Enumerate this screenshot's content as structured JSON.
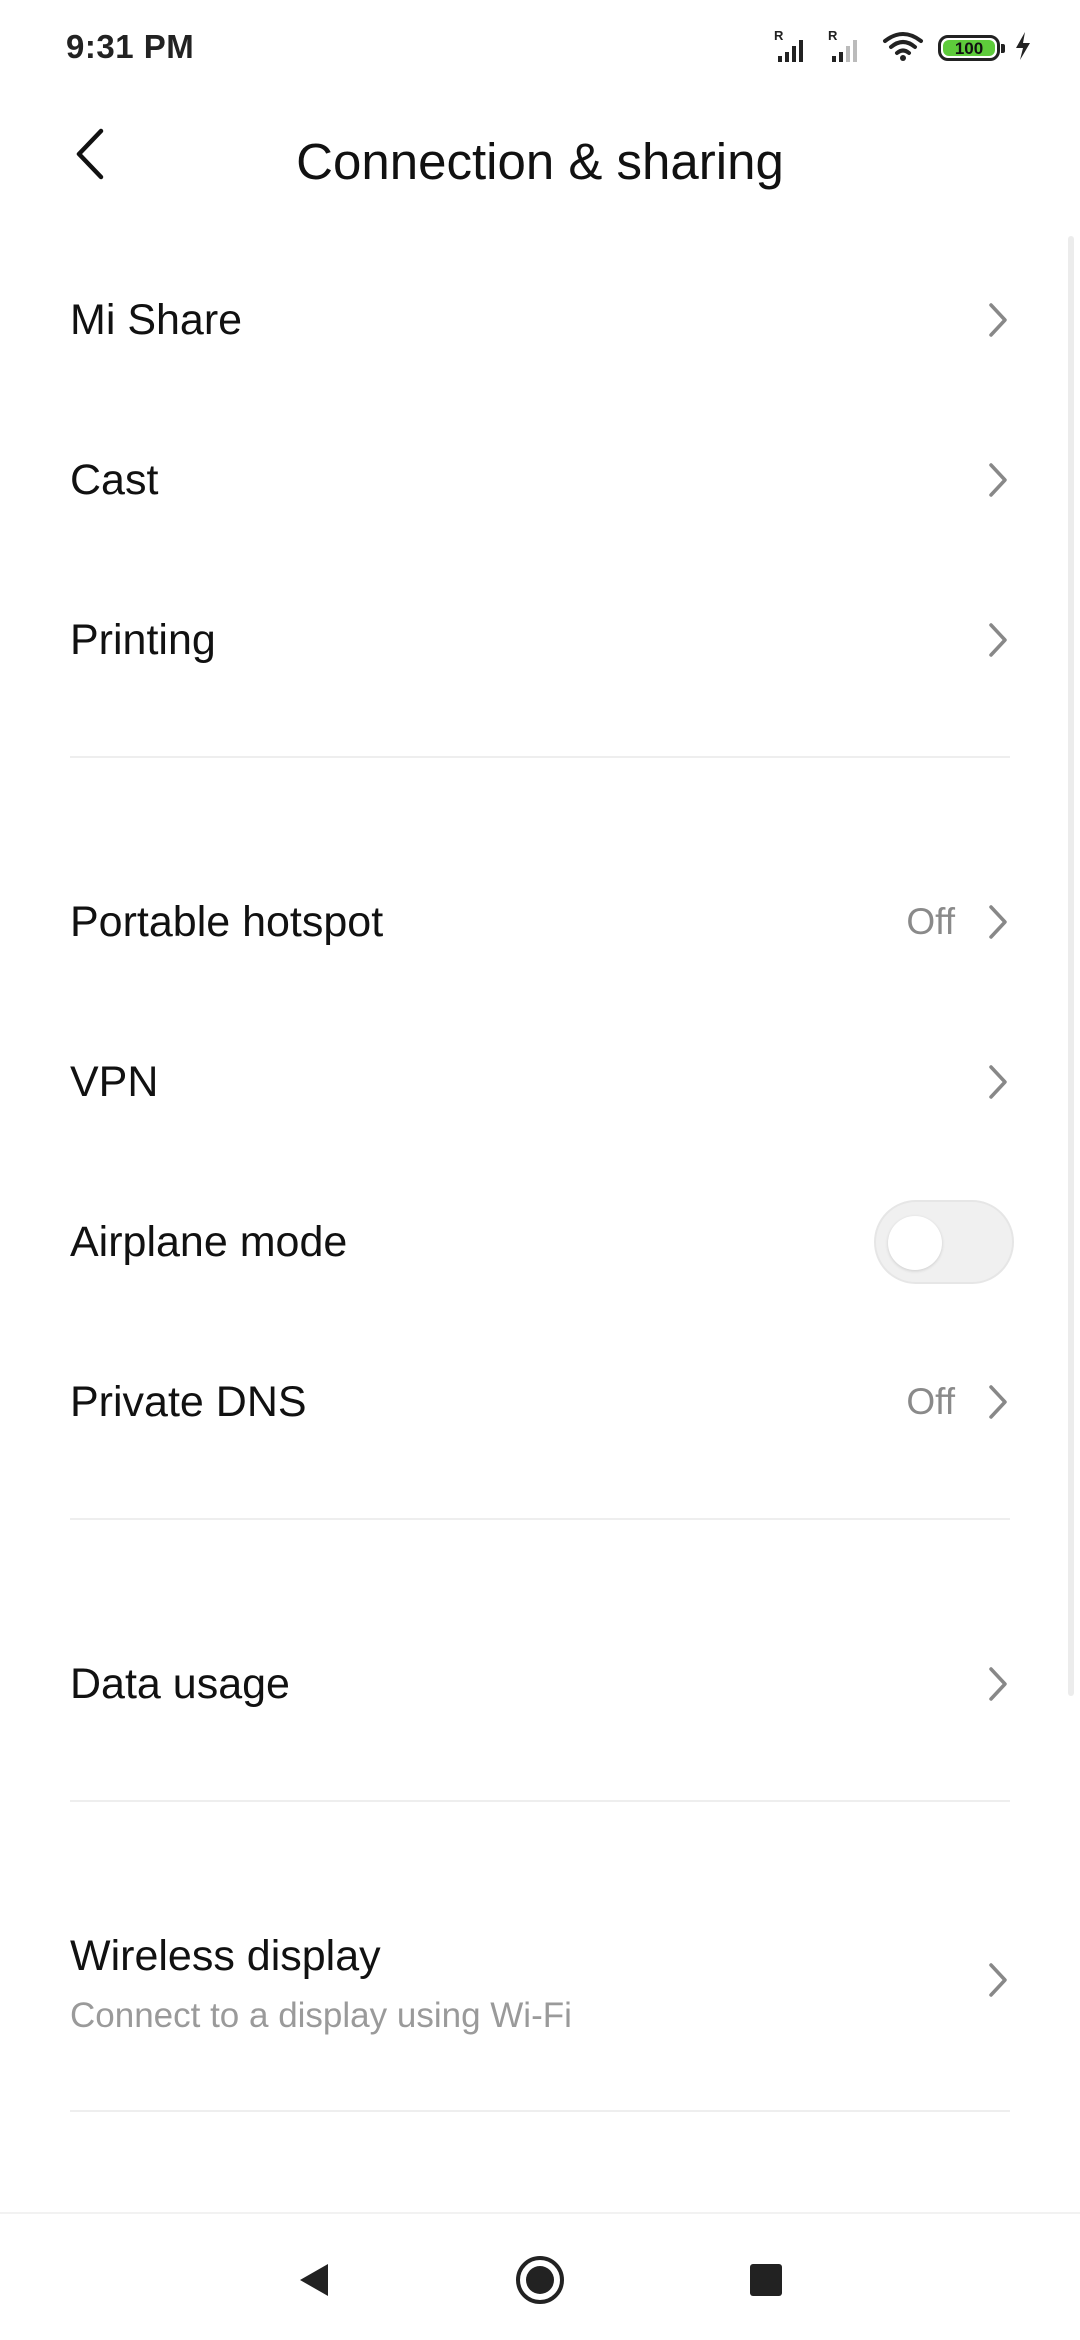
{
  "status_bar": {
    "time": "9:31 PM",
    "battery_level": "100",
    "icons": [
      "signal-roaming-icon",
      "signal-roaming-icon",
      "wifi-icon",
      "battery-icon",
      "charging-icon"
    ]
  },
  "header": {
    "title": "Connection & sharing",
    "back_icon": "back-arrow-icon"
  },
  "sections": [
    {
      "items": [
        {
          "label": "Mi Share"
        },
        {
          "label": "Cast"
        },
        {
          "label": "Printing"
        }
      ]
    },
    {
      "items": [
        {
          "label": "Portable hotspot",
          "value": "Off"
        },
        {
          "label": "VPN"
        },
        {
          "label": "Airplane mode",
          "toggle": false
        },
        {
          "label": "Private DNS",
          "value": "Off"
        }
      ]
    },
    {
      "items": [
        {
          "label": "Data usage"
        }
      ]
    },
    {
      "items": [
        {
          "label": "Wireless display",
          "sublabel": "Connect to a display using Wi-Fi"
        }
      ]
    }
  ],
  "nav_bar": {
    "icons": [
      "back-triangle-icon",
      "home-circle-icon",
      "recents-square-icon"
    ]
  },
  "colors": {
    "battery_fill": "#5ecb3b",
    "secondary_text": "#8a8a8a",
    "divider": "#eeeeee"
  }
}
